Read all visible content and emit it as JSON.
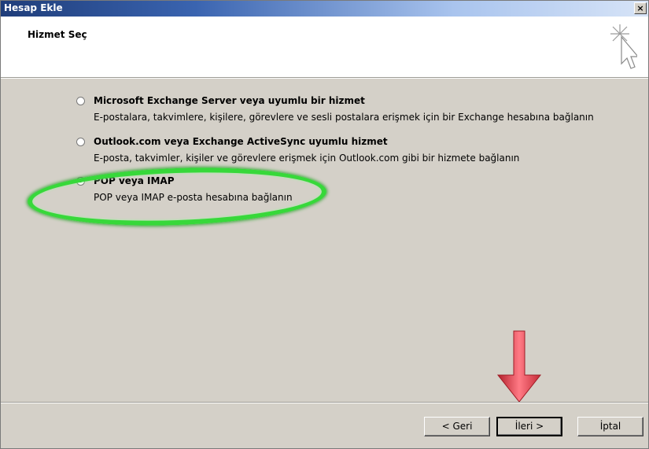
{
  "window": {
    "title": "Hesap Ekle",
    "close_glyph": "×"
  },
  "header": {
    "heading": "Hizmet Seç",
    "icon": "wizard-cursor-icon"
  },
  "options": [
    {
      "title": "Microsoft Exchange Server veya uyumlu bir hizmet",
      "description": "E-postalara, takvimlere, kişilere, görevlere ve sesli postalara erişmek için bir Exchange hesabına bağlanın",
      "selected": false
    },
    {
      "title": "Outlook.com veya Exchange ActiveSync uyumlu hizmet",
      "description": "E-posta, takvimler, kişiler ve görevlere erişmek için Outlook.com gibi bir hizmete bağlanın",
      "selected": false
    },
    {
      "title": "POP veya IMAP",
      "description": "POP veya IMAP e-posta hesabına bağlanın",
      "selected": true
    }
  ],
  "buttons": {
    "back": "< Geri",
    "next": "İleri >",
    "cancel": "İptal"
  },
  "colors": {
    "highlight": "#37d83a",
    "arrow": "#e84a55"
  }
}
